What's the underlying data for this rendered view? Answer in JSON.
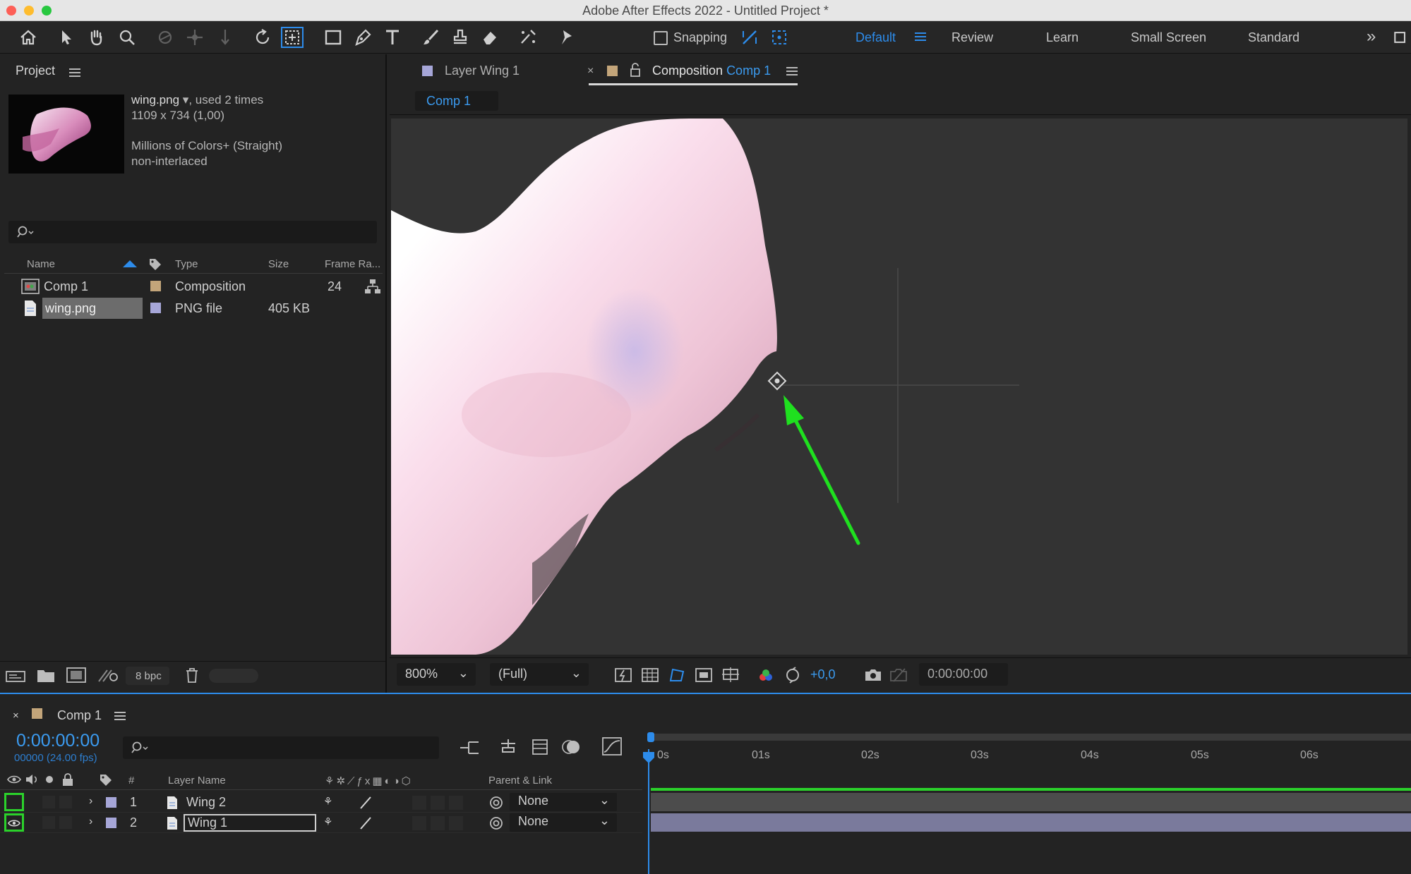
{
  "window": {
    "title": "Adobe After Effects 2022 - Untitled Project *"
  },
  "toolbar": {
    "snapping_label": "Snapping",
    "workspaces": [
      "Default",
      "Review",
      "Learn",
      "Small Screen",
      "Standard"
    ],
    "active_workspace": "Default",
    "accent": "#2d8ceb"
  },
  "project": {
    "panel_title": "Project",
    "asset": {
      "name": "wing.png",
      "usage": ", used 2 times",
      "dims": "1109 x 734 (1,00)",
      "colors": "Millions of Colors+ (Straight)",
      "interlace": "non-interlaced"
    },
    "columns": {
      "name": "Name",
      "type": "Type",
      "size": "Size",
      "frame_rate": "Frame Ra..."
    },
    "items": [
      {
        "name": "Comp 1",
        "type": "Composition",
        "size": "",
        "frame_rate": "24",
        "label_color": "#c3a57a"
      },
      {
        "name": "wing.png",
        "type": "PNG file",
        "size": "405 KB",
        "frame_rate": "",
        "label_color": "#a6a6d8"
      }
    ],
    "bit_depth": "8 bpc"
  },
  "viewer": {
    "tab_layer_prefix": "Layer",
    "tab_layer_name": "Wing 1",
    "tab_comp_prefix": "Composition",
    "tab_comp_name": "Comp 1",
    "comp_chip": "Comp 1",
    "zoom": "800%",
    "resolution": "(Full)",
    "exposure": "+0,0",
    "timecode": "0:00:00:00"
  },
  "timeline": {
    "tab_name": "Comp 1",
    "current_time": "0:00:00:00",
    "frame_info": "00000 (24.00 fps)",
    "ruler_ticks": [
      "0s",
      "01s",
      "02s",
      "03s",
      "04s",
      "05s",
      "06s"
    ],
    "columns": {
      "num": "#",
      "layer_name": "Layer Name",
      "parent": "Parent & Link"
    },
    "layers": [
      {
        "num": "1",
        "name": "Wing 2",
        "parent": "None",
        "visible": false
      },
      {
        "num": "2",
        "name": "Wing 1",
        "parent": "None",
        "visible": true
      }
    ]
  }
}
